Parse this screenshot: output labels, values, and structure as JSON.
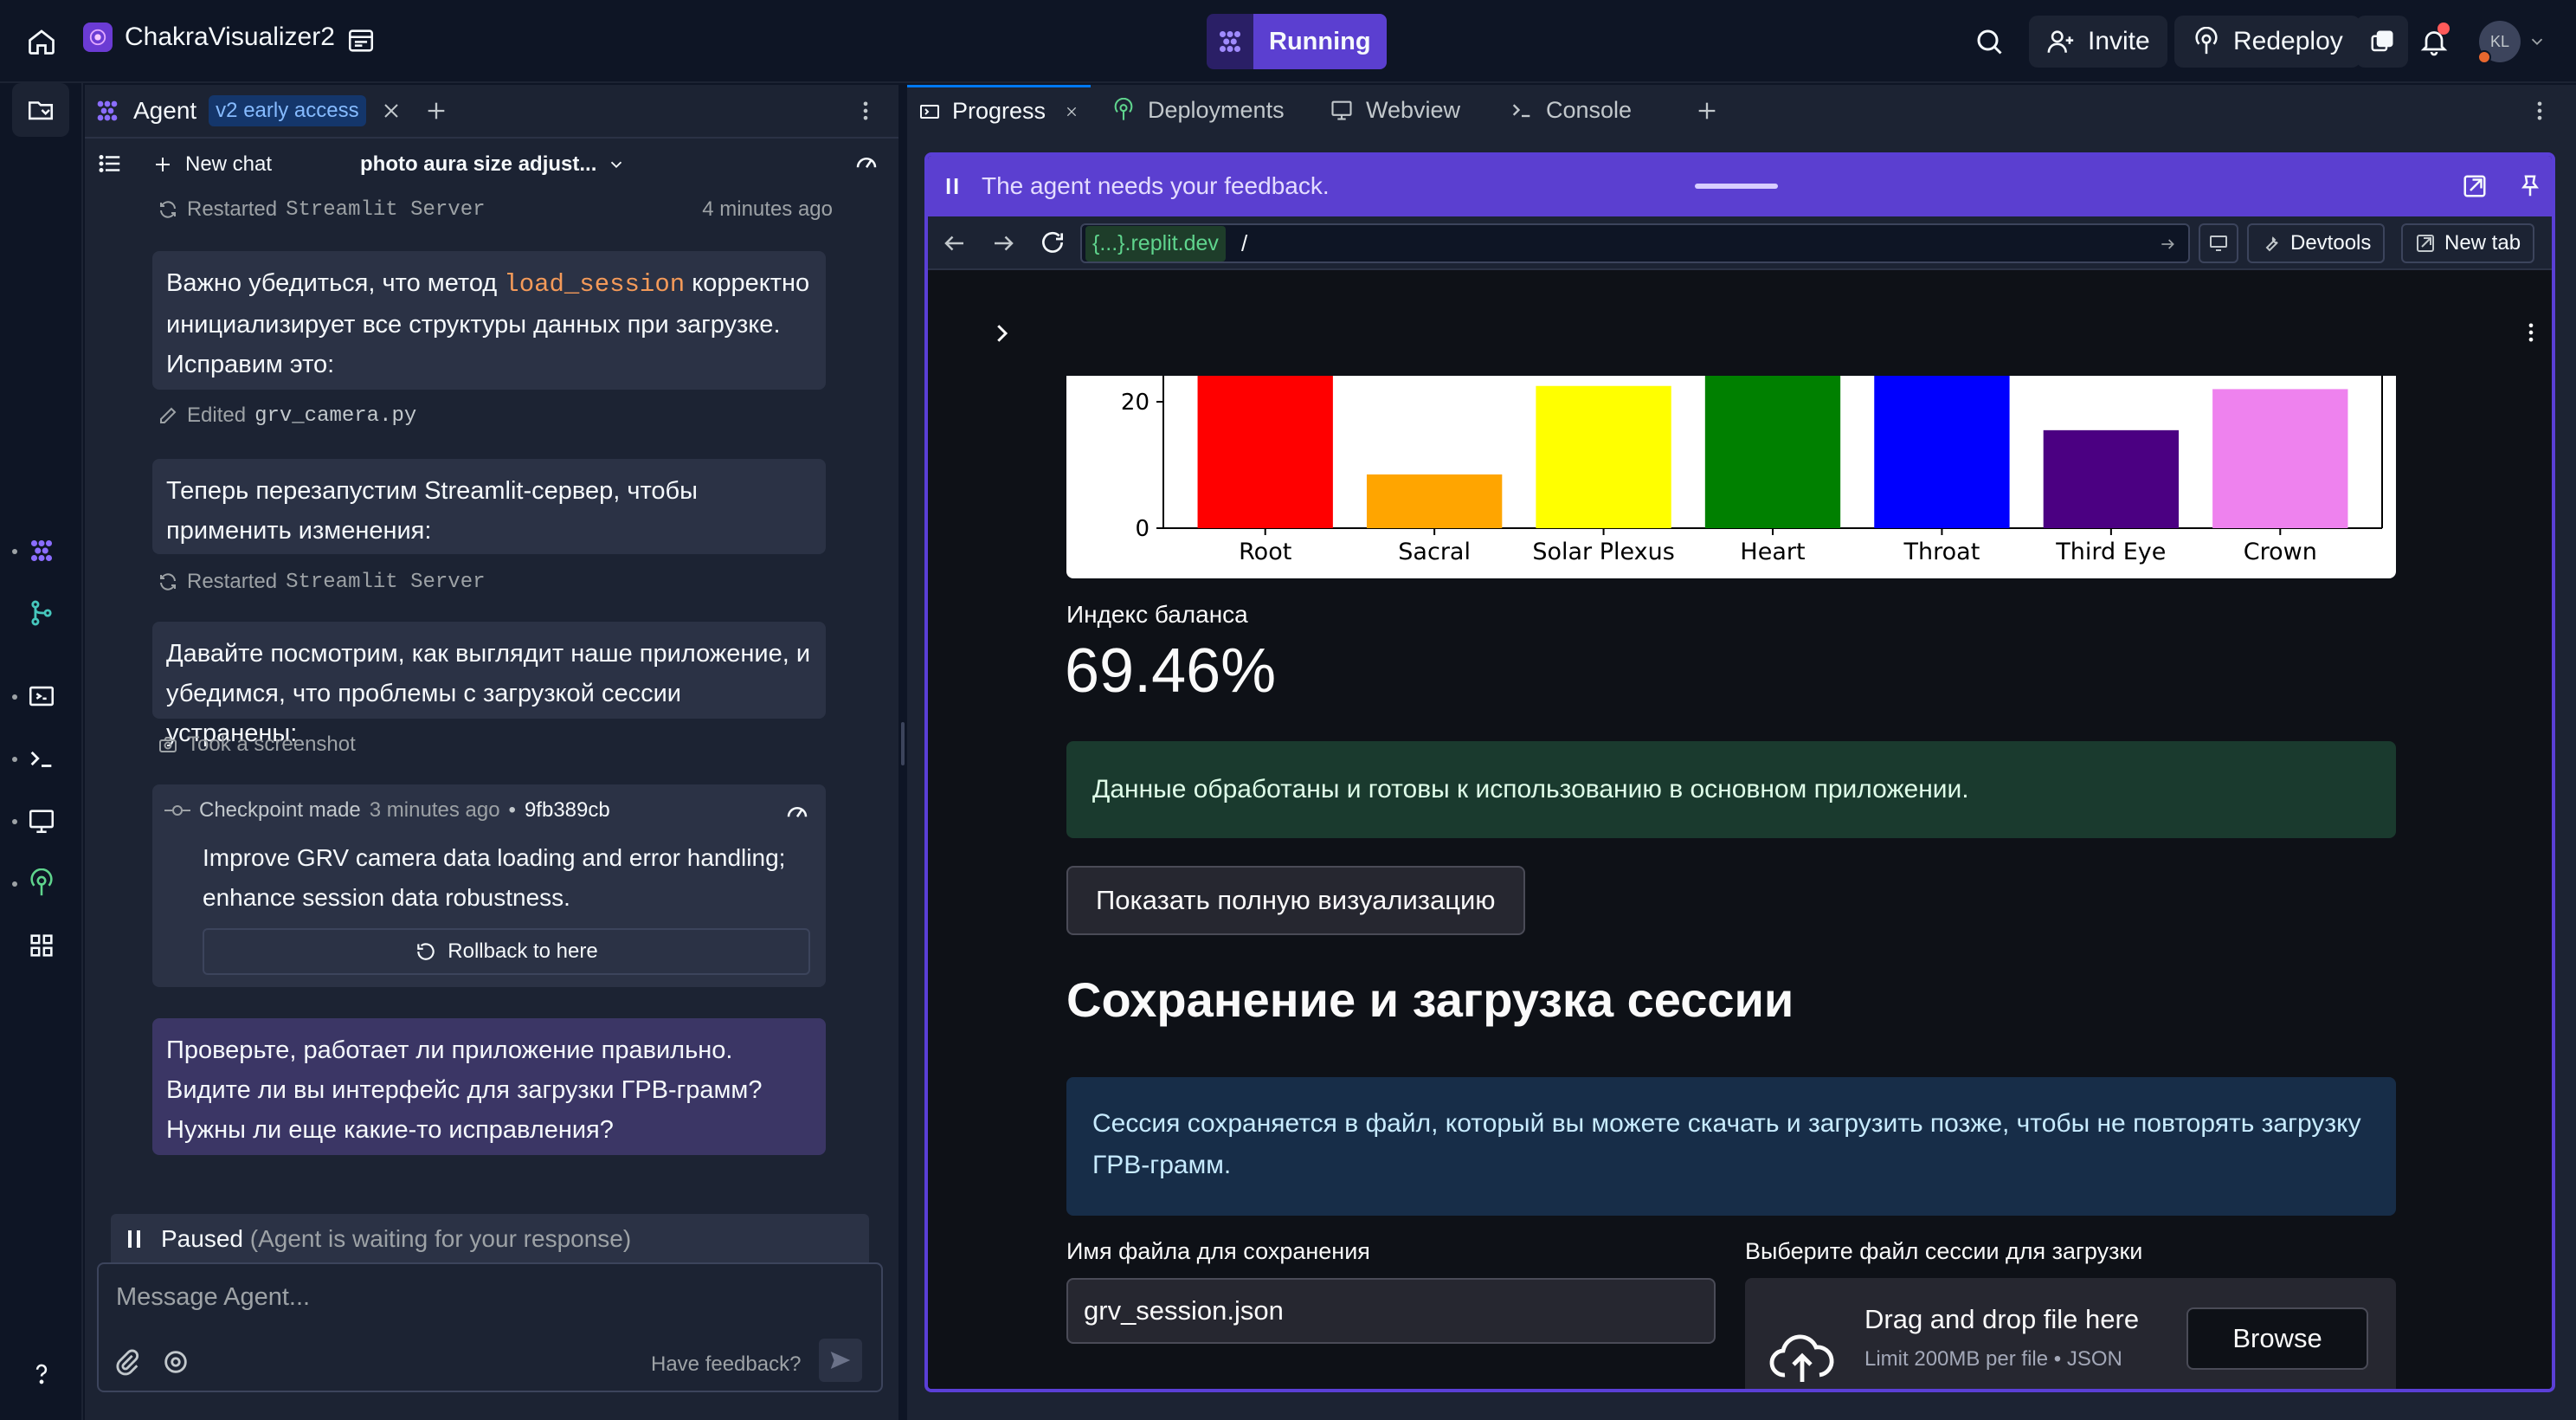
{
  "topbar": {
    "project_name": "ChakraVisualizer2",
    "run_label": "Running",
    "invite_label": "Invite",
    "redeploy_label": "Redeploy",
    "avatar_initials": "KL"
  },
  "agent": {
    "tab_label": "Agent",
    "tab_badge": "v2 early access",
    "new_chat_label": "New chat",
    "chat_title": "photo aura size adjust...",
    "restarted_1_prefix": "Restarted",
    "restarted_1_code": "Streamlit Server",
    "restarted_1_time": "4 minutes ago",
    "msg1_before": "Важно убедиться, что метод ",
    "msg1_code": "load_session",
    "msg1_after": " корректно инициализирует все структуры данных при загрузке. Исправим это:",
    "edited_prefix": "Edited",
    "edited_file": "grv_camera.py",
    "msg2": "Теперь перезапустим Streamlit-сервер, чтобы применить изменения:",
    "restarted_2_prefix": "Restarted",
    "restarted_2_code": "Streamlit Server",
    "msg3": "Давайте посмотрим, как выглядит наше приложение, и убедимся, что проблемы с загрузкой сессии устранены:",
    "screenshot_label": "Took a screenshot",
    "checkpoint_label": "Checkpoint made",
    "checkpoint_time": "3 minutes ago",
    "checkpoint_sep": "•",
    "checkpoint_hash": "9fb389cb",
    "checkpoint_desc": "Improve GRV camera data loading and error handling; enhance session data robustness.",
    "rollback_label": "Rollback to here",
    "msg4": "Проверьте, работает ли приложение правильно. Видите ли вы интерфейс для загрузки ГРВ-грамм? Нужны ли еще какие-то исправления?",
    "paused_label": "Paused",
    "paused_detail": "(Agent is waiting for your response)",
    "input_placeholder": "Message Agent...",
    "feedback_label": "Have feedback?"
  },
  "right_tabs": [
    {
      "label": "Progress"
    },
    {
      "label": "Deployments"
    },
    {
      "label": "Webview"
    },
    {
      "label": "Console"
    }
  ],
  "webview": {
    "feedback_text": "The agent needs your feedback.",
    "url_host": "{...}.replit.dev",
    "url_path": "/",
    "devtools_label": "Devtools",
    "new_tab_label": "New tab"
  },
  "streamlit": {
    "balance_label": "Индекс баланса",
    "balance_value": "69.46%",
    "success_text": "Данные обработаны и готовы к использованию в основном приложении.",
    "show_button": "Показать полную визуализацию",
    "section_title": "Сохранение и загрузка сессии",
    "info_text": "Сессия сохраняется в файл, который вы можете скачать и загрузить позже, чтобы не повторять загрузку ГРВ-грамм.",
    "filename_label": "Имя файла для сохранения",
    "filename_value": "grv_session.json",
    "upload_label": "Выберите файл сессии для загрузки",
    "dropzone_title": "Drag and drop file here",
    "dropzone_limit": "Limit 200MB per file • JSON",
    "browse_label": "Browse"
  },
  "chart_data": {
    "type": "bar",
    "categories": [
      "Root",
      "Sacral",
      "Solar Plexus",
      "Heart",
      "Throat",
      "Third Eye",
      "Crown"
    ],
    "values": [
      26,
      8.5,
      22.5,
      26,
      26,
      15.5,
      22
    ],
    "colors": [
      "#ff0000",
      "#ffa500",
      "#ffff00",
      "#008000",
      "#0000ff",
      "#4b0082",
      "#ee82ee"
    ],
    "yticks": [
      "0",
      "20"
    ],
    "ylim_visible": [
      0,
      25.5
    ]
  },
  "colors": {
    "accent": "#5b3fd0",
    "run_green_bg": "#4f2fc6",
    "success_bg": "#1a3a2e",
    "info_bg": "#172d48"
  }
}
